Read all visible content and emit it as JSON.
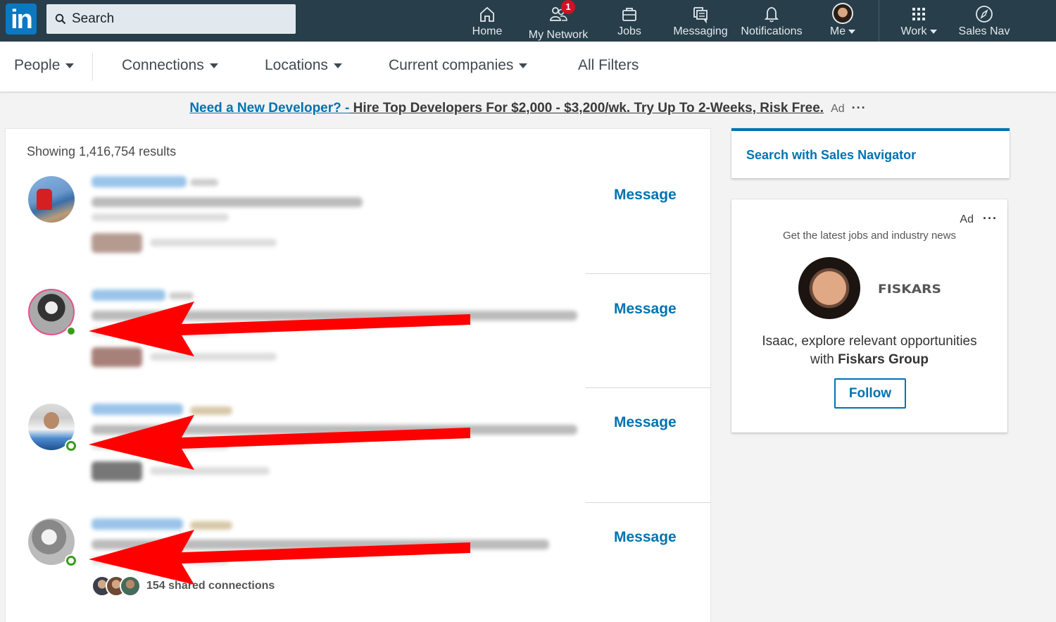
{
  "topbar": {
    "logo_text": "in",
    "search_placeholder": "Search",
    "nav": [
      {
        "label": "Home",
        "icon": "home-icon"
      },
      {
        "label": "My Network",
        "icon": "network-icon",
        "badge": "1"
      },
      {
        "label": "Jobs",
        "icon": "briefcase-icon"
      },
      {
        "label": "Messaging",
        "icon": "messaging-icon"
      },
      {
        "label": "Notifications",
        "icon": "bell-icon"
      },
      {
        "label": "Me",
        "icon": "avatar"
      },
      {
        "label": "Work",
        "icon": "grid-icon"
      },
      {
        "label": "Sales Nav",
        "icon": "compass-icon"
      }
    ]
  },
  "filters": {
    "items": [
      "People",
      "Connections",
      "Locations",
      "Current companies",
      "All Filters"
    ]
  },
  "ad_banner": {
    "link_text": "Need a New Developer? -",
    "body_text": " Hire Top Developers For $2,000 - $3,200/wk. Try Up To 2-Weeks, Risk Free.",
    "tag": "Ad",
    "more": "···"
  },
  "results": {
    "count_text": "Showing 1,416,754 results",
    "rows": [
      {
        "message_label": "Message",
        "online": "none"
      },
      {
        "message_label": "Message",
        "online": "active"
      },
      {
        "message_label": "Message",
        "online": "ring"
      },
      {
        "message_label": "Message",
        "online": "ring",
        "shared_connections": "154 shared connections"
      }
    ]
  },
  "sidebar": {
    "sales_nav_link": "Search with Sales Navigator",
    "ad": {
      "tag": "Ad",
      "more": "···",
      "subtitle": "Get the latest jobs and industry news",
      "brand": "FISKARS",
      "pitch_prefix": "Isaac, explore relevant opportunities",
      "pitch_with": "with ",
      "pitch_company": "Fiskars Group",
      "follow_label": "Follow"
    }
  },
  "annotation": {
    "arrow_color": "#ff0000",
    "arrow_count": 3
  },
  "colors": {
    "topbar_bg": "#283e4a",
    "brand_blue": "#0073b1",
    "presence_green": "#3c9a1e",
    "badge_red": "#d11124"
  }
}
